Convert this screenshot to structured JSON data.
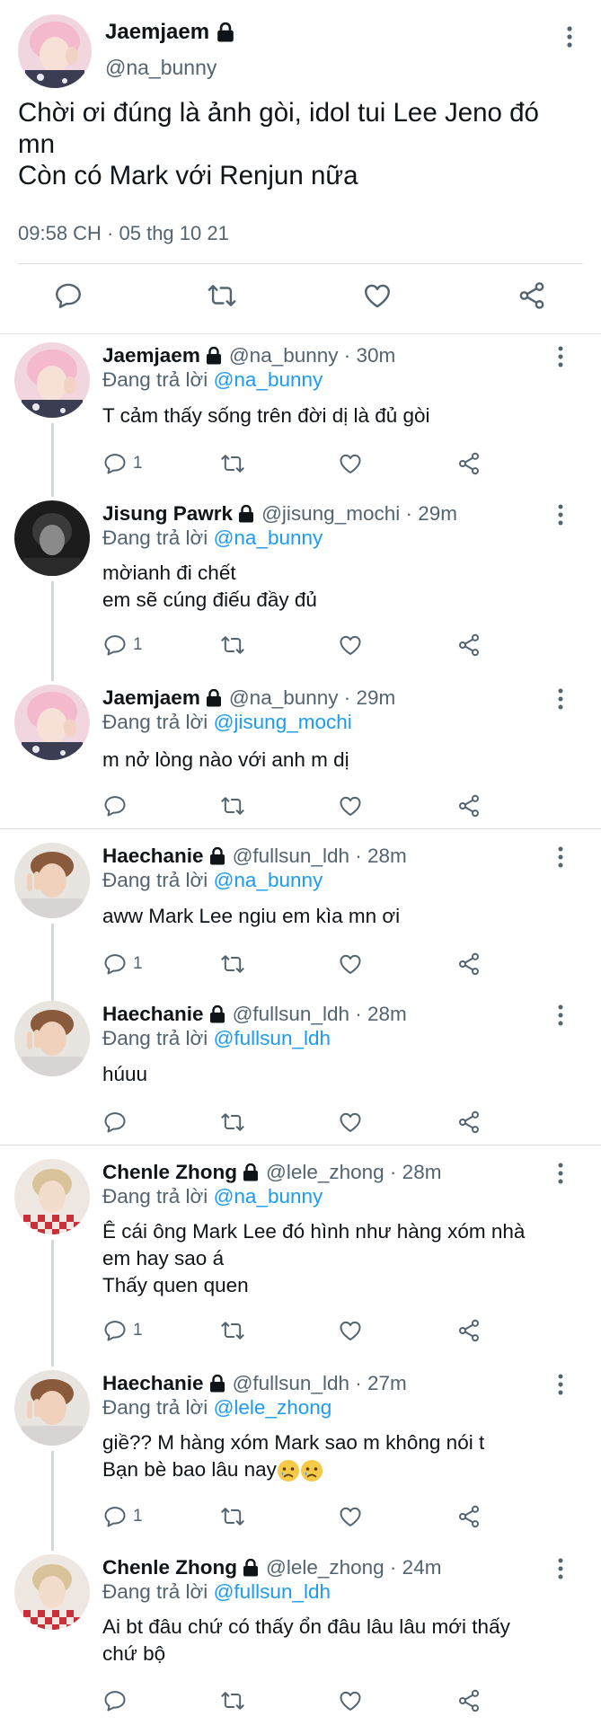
{
  "main_tweet": {
    "author_name": "Jaemjaem",
    "author_handle": "@na_bunny",
    "text_lines": [
      "Chời ơi đúng là ảnh gòi, idol tui Lee Jeno đó",
      "mn",
      "Còn có Mark với Renjun nữa"
    ],
    "timestamp": "09:58 CH · 05 thg 10 21"
  },
  "replying_label": "Đang trả lời",
  "colors": {
    "text": "#0f1419",
    "secondary": "#536471",
    "link": "#1d9bf0",
    "divider": "#dfe3e6",
    "thread_line": "#cfd9de"
  },
  "replies": [
    {
      "name": "Jaemjaem",
      "meta": "@na_bunny · 30m",
      "replying_to": "@na_bunny",
      "lines": [
        "T cảm thấy sống trên đời dị là đủ gòi"
      ],
      "reply_count": "1",
      "avatar": "pink-hair-avatar"
    },
    {
      "name": "Jisung Pawrk",
      "meta": "@jisung_mochi · 29m",
      "replying_to": "@na_bunny",
      "lines": [
        "mờianh đi chết",
        "em sẽ cúng điếu đầy đủ"
      ],
      "reply_count": "1",
      "avatar": "dark-avatar"
    },
    {
      "name": "Jaemjaem",
      "meta": "@na_bunny · 29m",
      "replying_to": "@jisung_mochi",
      "lines": [
        "m nở lòng nào với anh m dị"
      ],
      "reply_count": "",
      "avatar": "pink-hair-avatar"
    },
    {
      "name": "Haechanie",
      "meta": "@fullsun_ldh · 28m",
      "replying_to": "@na_bunny",
      "lines": [
        "aww Mark Lee ngiu em kìa mn ơi"
      ],
      "reply_count": "1",
      "avatar": "peace-sign-avatar"
    },
    {
      "name": "Haechanie",
      "meta": "@fullsun_ldh · 28m",
      "replying_to": "@fullsun_ldh",
      "lines": [
        "húuu"
      ],
      "reply_count": "",
      "avatar": "peace-sign-avatar"
    },
    {
      "name": "Chenle Zhong",
      "meta": "@lele_zhong · 28m",
      "replying_to": "@na_bunny",
      "lines": [
        "Ê cái ông Mark Lee đó hình như hàng xóm nhà",
        "em hay sao á",
        "Thấy quen quen"
      ],
      "reply_count": "1",
      "avatar": "checkered-shirt-avatar"
    },
    {
      "name": "Haechanie",
      "meta": "@fullsun_ldh · 27m",
      "replying_to": "@lele_zhong",
      "lines": [
        "giề??  M hàng xóm Mark sao m không nói t",
        "Bạn bè bao lâu nay"
      ],
      "emoji_after_last_line": "crying-face-emoji",
      "reply_count": "1",
      "avatar": "peace-sign-avatar"
    },
    {
      "name": "Chenle Zhong",
      "meta": "@lele_zhong · 24m",
      "replying_to": "@fullsun_ldh",
      "lines": [
        "Ai bt đâu chứ có thấy ổn đâu lâu lâu mới thấy",
        "chứ bộ"
      ],
      "reply_count": "",
      "avatar": "checkered-shirt-avatar"
    }
  ]
}
